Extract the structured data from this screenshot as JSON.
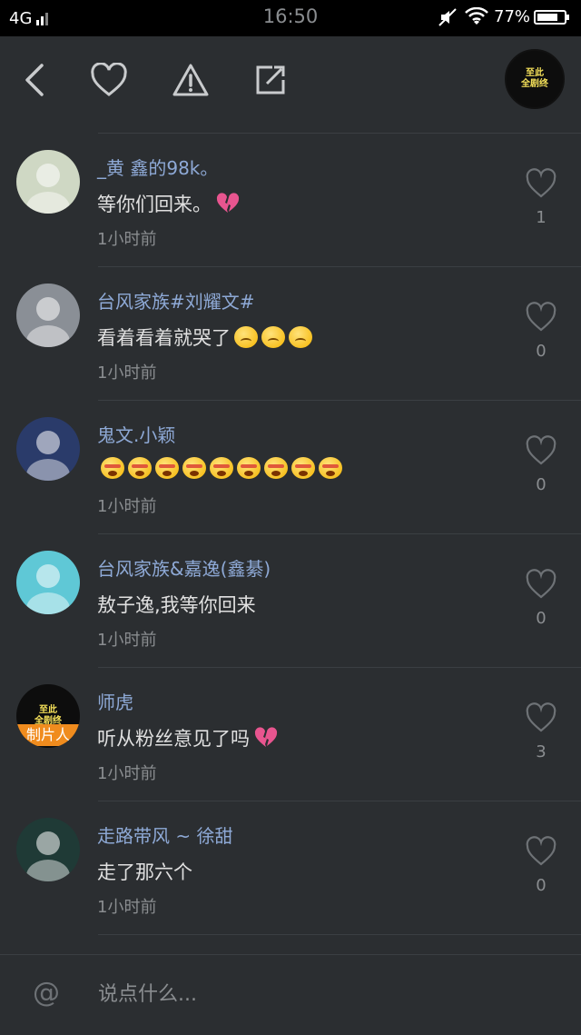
{
  "status_bar": {
    "network": "4G",
    "time": "16:50",
    "battery": "77%",
    "battery_level": 0.77
  },
  "toolbar": {
    "logo_line1": "至此",
    "logo_line2": "全剧终"
  },
  "comments": [
    {
      "name": "_黄 鑫的98k。",
      "text": "等你们回来。",
      "emoji": "broken-heart",
      "time": "1小时前",
      "likes": "1",
      "avatar_color": "#cfd8c4"
    },
    {
      "name": "台风家族#刘耀文#",
      "text": "看着看着就哭了",
      "emoji": "sad-x3",
      "time": "1小时前",
      "likes": "0",
      "avatar_color": "#8a8f96"
    },
    {
      "name": "鬼文.小颖",
      "text": "",
      "emoji": "cry-x9",
      "time": "1小时前",
      "likes": "0",
      "avatar_color": "#2a3b6a"
    },
    {
      "name": "台风家族&嘉逸(鑫綦)",
      "text": "敖子逸,我等你回来",
      "emoji": "",
      "time": "1小时前",
      "likes": "0",
      "avatar_color": "#5fc8d6"
    },
    {
      "name": "师虎",
      "text": "听从粉丝意见了吗",
      "emoji": "broken-heart",
      "time": "1小时前",
      "likes": "3",
      "avatar_color": "#0d0d0d",
      "badge": "制片人",
      "logo_line1": "至此",
      "logo_line2": "全剧终"
    },
    {
      "name": "走路带风 ~ 徐甜",
      "text": "走了那六个",
      "emoji": "",
      "time": "1小时前",
      "likes": "0",
      "avatar_color": "#1f3a36"
    }
  ],
  "input": {
    "at_symbol": "@",
    "placeholder": "说点什么..."
  },
  "colors": {
    "background": "#2b2e31",
    "name": "#8ea9d6",
    "muted": "#8a8d90"
  }
}
